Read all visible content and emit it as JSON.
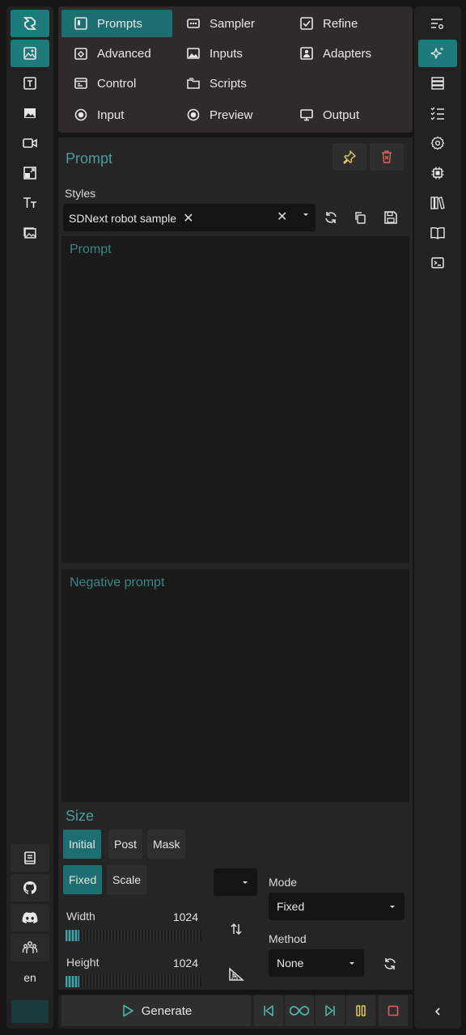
{
  "tabs": [
    {
      "label": "Prompts",
      "icon": "prompts-icon",
      "active": true
    },
    {
      "label": "Sampler",
      "icon": "sampler-icon"
    },
    {
      "label": "Refine",
      "icon": "refine-icon"
    },
    {
      "label": "Advanced",
      "icon": "advanced-icon"
    },
    {
      "label": "Inputs",
      "icon": "inputs-icon"
    },
    {
      "label": "Adapters",
      "icon": "adapters-icon"
    },
    {
      "label": "Control",
      "icon": "control-icon"
    },
    {
      "label": "Scripts",
      "icon": "scripts-icon"
    },
    {
      "label": "Input",
      "icon": "radio-icon"
    },
    {
      "label": "Preview",
      "icon": "radio-icon"
    },
    {
      "label": "Output",
      "icon": "monitor-icon"
    }
  ],
  "prompt": {
    "title": "Prompt",
    "styles_label": "Styles",
    "style_chip": "SDNext robot sample",
    "prompt_placeholder": "Prompt",
    "negative_placeholder": "Negative prompt"
  },
  "size": {
    "title": "Size",
    "tabs": [
      "Initial",
      "Post",
      "Mask"
    ],
    "subtabs": [
      "Fixed",
      "Scale"
    ],
    "mode_label": "Mode",
    "mode_value": "Fixed",
    "method_label": "Method",
    "method_value": "None",
    "width_label": "Width",
    "width_value": "1024",
    "height_label": "Height",
    "height_value": "1024",
    "width_fraction": 0.1,
    "height_fraction": 0.1
  },
  "bottom": {
    "generate_label": "Generate"
  },
  "left_rail": {
    "language": "en"
  },
  "colors": {
    "accent": "#1c6e70",
    "accent_text": "#4e9a9b",
    "background": "#151515",
    "panel": "#252525"
  }
}
